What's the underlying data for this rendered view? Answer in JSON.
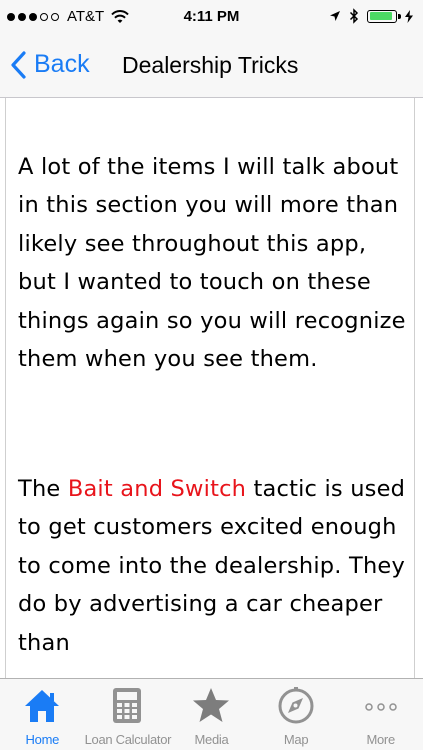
{
  "status_bar": {
    "carrier": "AT&T",
    "time": "4:11 PM",
    "signal_bars_filled": 3,
    "signal_bars_total": 5,
    "battery_level": 0.9,
    "icons": [
      "wifi-icon",
      "location-arrow-icon",
      "bluetooth-icon",
      "battery-icon",
      "charging-bolt-icon"
    ]
  },
  "nav": {
    "back_label": "Back",
    "title": "Dealership Tricks"
  },
  "content": {
    "paragraph_1": "A lot of the items I will talk about in this section you will more than likely see throughout this app, but I wanted to touch on these things again so you will recognize them when you see them.",
    "paragraph_2_prefix": "The ",
    "paragraph_2_highlight": "Bait and Switch",
    "paragraph_2_suffix": " tactic is used to get customers excited enough to come into the dealership. They do by advertising a car cheaper than"
  },
  "tabs": [
    {
      "label": "Home",
      "icon": "home-icon",
      "active": true
    },
    {
      "label": "Loan Calculator",
      "icon": "calculator-icon",
      "active": false
    },
    {
      "label": "Media",
      "icon": "star-icon",
      "active": false
    },
    {
      "label": "Map",
      "icon": "compass-icon",
      "active": false
    },
    {
      "label": "More",
      "icon": "more-dots-icon",
      "active": false
    }
  ],
  "colors": {
    "accent": "#1a7cf5",
    "highlight_text": "#e8141b",
    "battery": "#4cd964",
    "tab_inactive": "#929292"
  }
}
